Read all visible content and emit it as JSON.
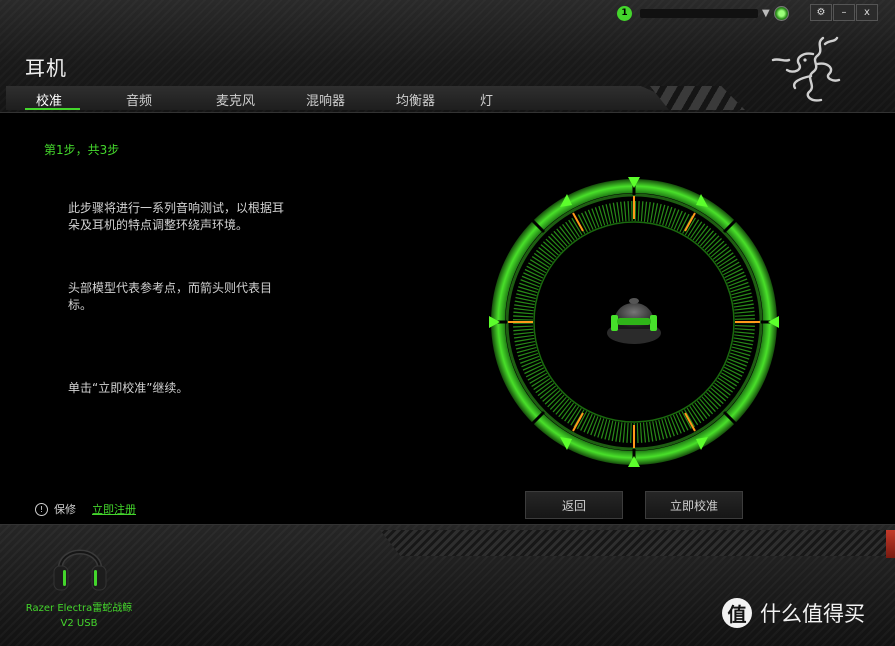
{
  "window": {
    "title": "耳机",
    "notification_count": "1",
    "controls": [
      "⚙",
      "–",
      "x"
    ]
  },
  "tabs": [
    "校准",
    "音频",
    "麦克风",
    "混响器",
    "均衡器",
    "灯"
  ],
  "active_tab": "校准",
  "main": {
    "step": "第1步，共3步",
    "paragraphs": [
      "此步骤将进行一系列音响测试，以根据耳朵及耳机的特点调整环绕声环境。",
      "头部模型代表参考点，而箭头则代表目标。",
      "单击“立即校准”继续。"
    ],
    "back_label": "返回",
    "calibrate_label": "立即校准"
  },
  "footer": {
    "warranty_label": "保修",
    "register_label": "立即注册",
    "device_name_line1": "Razer Electra雷蛇战鲸",
    "device_name_line2": "V2 USB"
  },
  "watermark": {
    "icon_text": "值",
    "text": "什么值得买"
  },
  "colors": {
    "accent": "#44d62c",
    "marker": "#ff9a1a",
    "background": "#000000"
  }
}
